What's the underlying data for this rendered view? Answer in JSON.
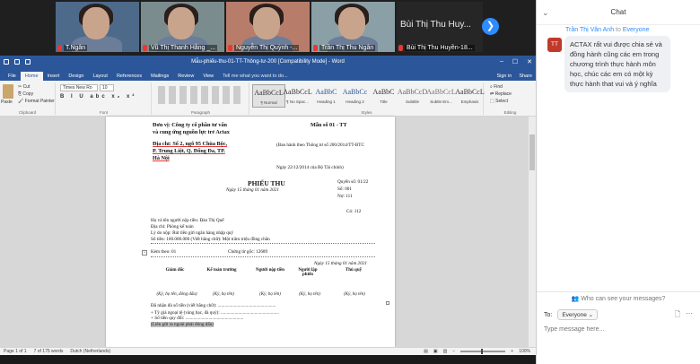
{
  "video": {
    "tiles": [
      {
        "name": "T.Ngân",
        "muted": true
      },
      {
        "name": "Vũ Thị Thanh Hằng _...",
        "muted": true
      },
      {
        "name": "Nguyễn Thị Quỳnh -...",
        "muted": true
      },
      {
        "name": "Trần Thị Thu Ngân",
        "muted": true
      },
      {
        "name": "Bùi Thị Thu Huyền-18...",
        "big_name": "Bùi Thị Thu Huy...",
        "muted": true
      }
    ],
    "next_icon": "chevron-right-icon"
  },
  "word": {
    "title": "Mẫu-phiếu-thu-01-TT-Thông-tư-200 [Compatibility Mode] - Word",
    "tabs": [
      "File",
      "Home",
      "Insert",
      "Design",
      "Layout",
      "References",
      "Mailings",
      "Review",
      "View"
    ],
    "active_tab": "Home",
    "tell_me": "Tell me what you want to do...",
    "sign_in": "Sign in",
    "share": "Share",
    "clipboard": {
      "paste": "Paste",
      "cut": "Cut",
      "copy": "Copy",
      "painter": "Format Painter",
      "label": "Clipboard"
    },
    "font": {
      "name": "Times New Ro",
      "size": "10",
      "buttons": "B I U abc x₂ x²",
      "label": "Font"
    },
    "paragraph_label": "Paragraph",
    "styles": [
      {
        "sample": "AaBbCcL",
        "name": "¶ Normal"
      },
      {
        "sample": "AaBbCcL",
        "name": "¶ No Spac..."
      },
      {
        "sample": "AaBbC",
        "name": "Heading 1"
      },
      {
        "sample": "AaBbCc",
        "name": "Heading 2"
      },
      {
        "sample": "AaBbC",
        "name": "Title"
      },
      {
        "sample": "AaBbCcD",
        "name": "Subtitle"
      },
      {
        "sample": "AaBbCcL",
        "name": "Subtle Em..."
      },
      {
        "sample": "AaBbCcL",
        "name": "Emphasis"
      }
    ],
    "styles_label": "Styles",
    "editing": {
      "find": "Find",
      "replace": "Replace",
      "select": "Select",
      "label": "Editing"
    },
    "status": {
      "page": "Page 1 of 1",
      "words": "7 of 175 words",
      "language": "Dutch (Netherlands)",
      "zoom": "100%"
    }
  },
  "doc": {
    "unit": "Đơn vị: Công ty cổ phần tư vấn",
    "unit2": "và cung ứng nguồn lực trẻ Actax",
    "form_no": "Mẫu số 01 - TT",
    "address1": "Địa chỉ: Số 2, ngõ 95 Chùa Bộc,",
    "address2": "P. Trung Liệt, Q. Đống Đa, TP.",
    "address3": "Hà Nội",
    "circular": "(Ban hành theo Thông tư số 200/2014/TT-BTC",
    "circular_date": "Ngày 22/12/2014 của Bộ Tài chính)",
    "heading": "PHIẾU THU",
    "date": "Ngày 15 tháng 01 năm 2021",
    "book": "Quyển số: 01/22",
    "number": "Số: 001",
    "debit": "Nợ: 111",
    "credit": "Có: 112",
    "payer": "Họ và tên người nộp tiền: Đào Thị Quế",
    "address": "Địa chỉ: Phòng kế toán",
    "reason": "Lý do nộp: Rút tiền gửi ngân hàng nhập quỹ",
    "amount": "Số tiền: 100.000.000   (Viết bằng chữ): Một trăm triệu đồng chẵn",
    "attached": "Kèm theo: 01",
    "original_docs": "Chứng từ gốc: 12689",
    "date2": "Ngày 15 tháng 01 năm 2021",
    "signers": [
      "Giám đốc",
      "Kế toán trưởng",
      "Người nộp tiền",
      "Người lập phiếu",
      "Thủ quỹ"
    ],
    "sign_note": "(Ký, họ tên)",
    "sign_note_stamp": "(Ký, họ tên, đóng dấu)",
    "received": "Đã nhận đủ số tiền (viết bằng chữ): ..................................................",
    "fx": "+ Tỷ giá ngoại tệ (vàng bạc, đá quý): ..................................................",
    "converted": "+ Số tiền quy đổi: ..................................................",
    "copy_note": "(Liên gửi ra ngoài phải đóng dấu)"
  },
  "chat": {
    "title": "Chat",
    "from": "Trần Thị Vân Anh",
    "to_word": "to",
    "to": "Everyone",
    "avatar": "TT",
    "message": "ACTAX rất vui được chia sẻ và đồng hành cũng các em trong chương trình thực hành môn học, chúc các em có một kỳ thực hành that vui và ý nghĩa",
    "who_can_see": "Who can see your messages?",
    "to_label": "To:",
    "recipient": "Everyone",
    "placeholder": "Type message here..."
  }
}
